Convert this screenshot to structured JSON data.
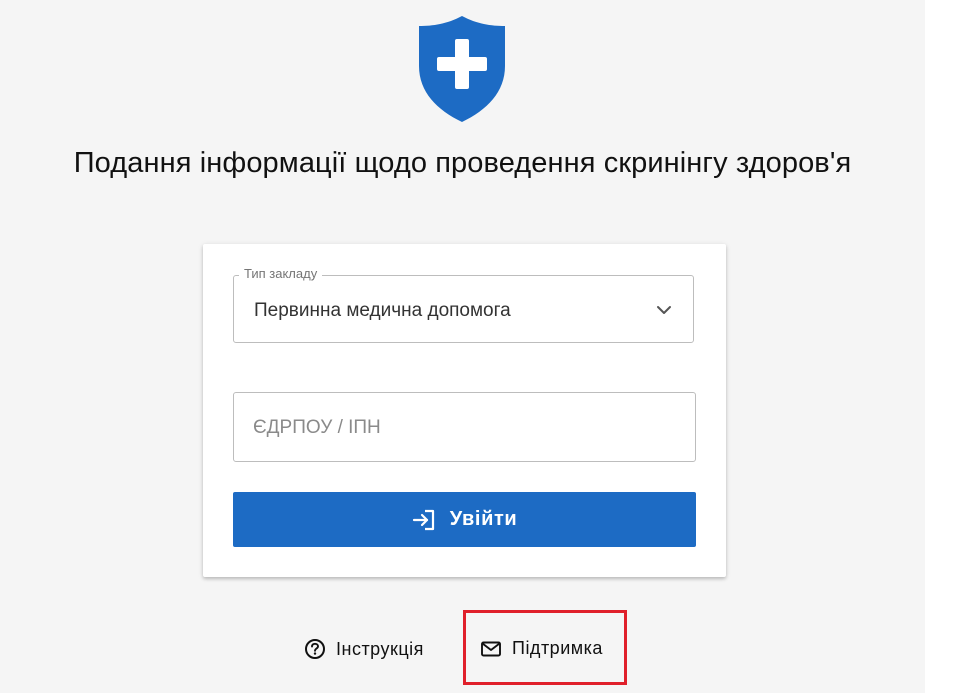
{
  "header": {
    "title": "Подання інформації щодо проведення скринінгу здоров'я",
    "logo_icon": "shield-cross-icon",
    "logo_color": "#1d6bc4"
  },
  "form": {
    "facility_type": {
      "legend": "Тип закладу",
      "selected_value": "Первинна медична допомога",
      "icon": "chevron-down-icon"
    },
    "edrpou": {
      "placeholder": "ЄДРПОУ / ІПН",
      "value": ""
    },
    "login_button": {
      "label": "Увійти",
      "icon": "login-icon",
      "color": "#1d6bc4"
    }
  },
  "footer": {
    "instructions": {
      "label": "Інструкція",
      "icon": "help-circle-icon"
    },
    "support": {
      "label": "Підтримка",
      "icon": "mail-icon",
      "highlight_color": "#e0202b"
    }
  }
}
